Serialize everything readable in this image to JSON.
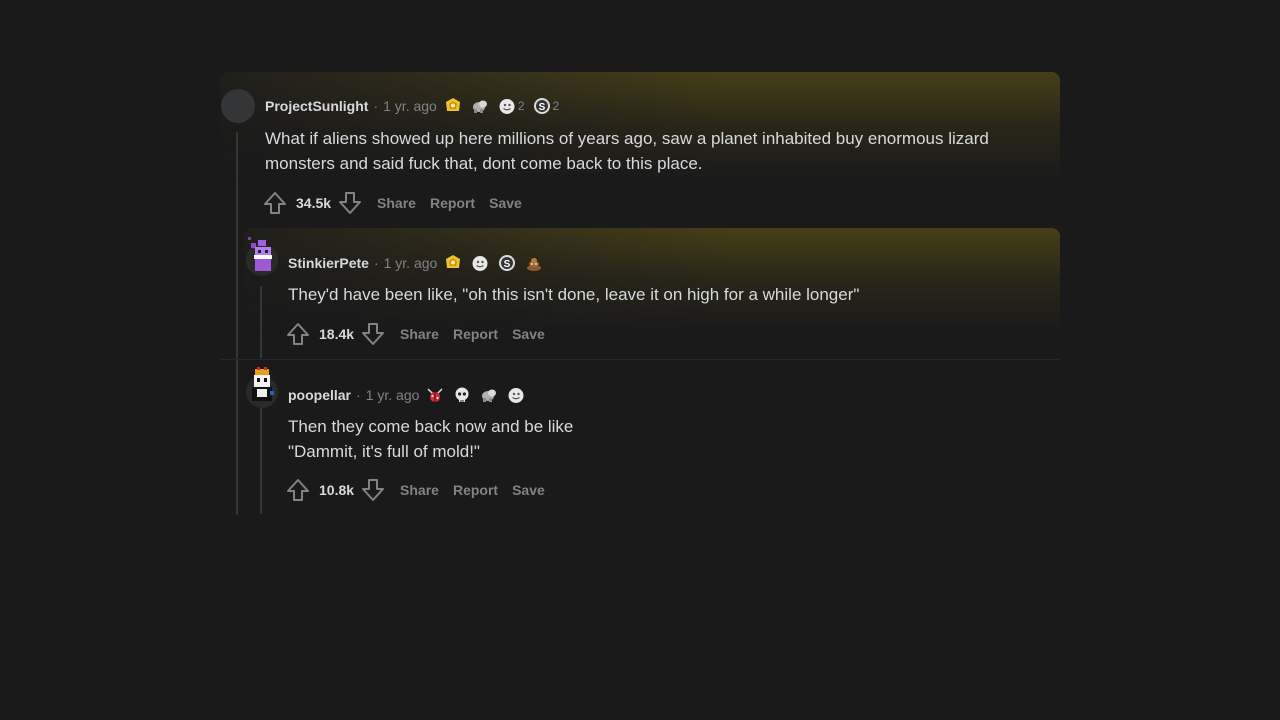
{
  "comments": [
    {
      "author": "ProjectSunlight",
      "age": "1 yr. ago",
      "award_counts": [
        "2",
        "2"
      ],
      "body_lines": [
        "What if aliens showed up here millions of years ago, saw a planet inhabited buy enormous lizard",
        "monsters and said fuck that, dont come back to this place."
      ],
      "score": "34.5k",
      "actions": [
        "Share",
        "Report",
        "Save"
      ]
    },
    {
      "author": "StinkierPete",
      "age": "1 yr. ago",
      "body_lines": [
        "They'd have been like, \"oh this isn't done, leave it on high for a while longer\""
      ],
      "score": "18.4k",
      "actions": [
        "Share",
        "Report",
        "Save"
      ]
    },
    {
      "author": "poopellar",
      "age": "1 yr. ago",
      "body_lines": [
        "Then they come back now and be like",
        "\"Dammit, it's full of mold!\""
      ],
      "score": "10.8k",
      "actions": [
        "Share",
        "Report",
        "Save"
      ]
    }
  ],
  "awards": {
    "c1": [
      "gold-award-icon",
      "wholesome-award-icon",
      "silver-award-icon",
      "snoo-award-icon"
    ],
    "c2": [
      "gold-award-icon",
      "silver-award-icon",
      "snoo-award-icon",
      "poop-award-icon"
    ],
    "c3": [
      "bug-award-icon",
      "skull-award-icon",
      "wholesome-award-icon",
      "silver-award-icon"
    ]
  },
  "colors": {
    "background": "#1a1a1b",
    "text": "#d7dadc",
    "muted": "#818384",
    "highlight": "#544a18",
    "thread_line": "#343536"
  }
}
